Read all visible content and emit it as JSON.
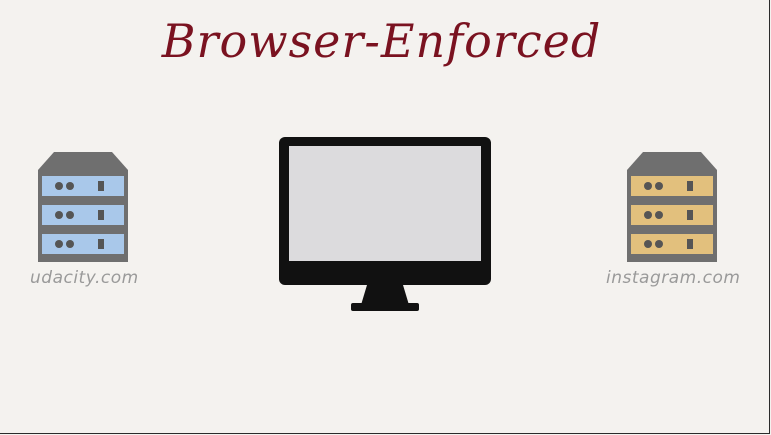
{
  "title": "Browser-Enforced",
  "servers": [
    {
      "label": "udacity.com",
      "color": "#a9c8ea"
    },
    {
      "label": "instagram.com",
      "color": "#e2c07d"
    }
  ],
  "monitor": {
    "screen_color": "#dcdbdd"
  }
}
